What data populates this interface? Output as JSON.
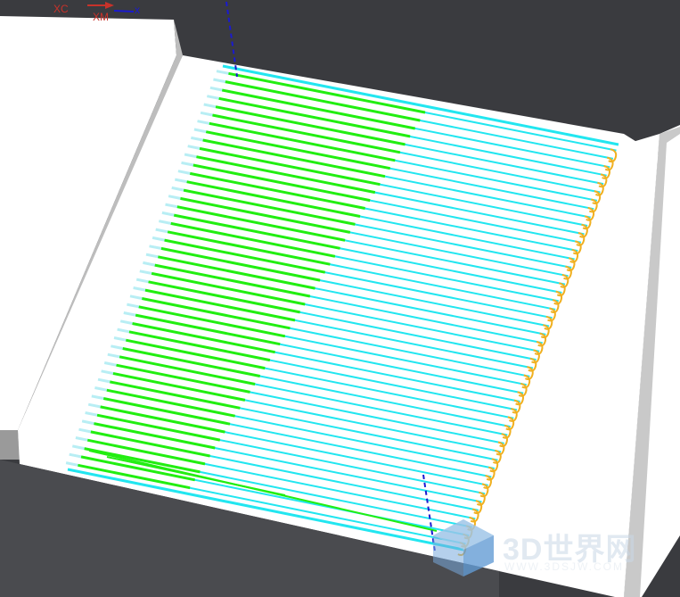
{
  "triad": {
    "xc_label": "XC",
    "xm_label": "XM",
    "x_label": "x",
    "xc_color": "#c8322a",
    "xm_color": "#c8322a",
    "x_color": "#1a1ad0"
  },
  "colors": {
    "background": "#3a3b3f",
    "part_top": "#ffffff",
    "part_wall": "#bdbdbd",
    "part_dark": "#4a4b4f",
    "toolpath_cut": "#22ee11",
    "toolpath_move": "#22e6f0",
    "toolpath_move_light": "#b8eef4",
    "toolpath_arc": "#f0b020",
    "engage_line": "#1a1ad0"
  },
  "toolpath": {
    "pass_count": 48,
    "pattern": "zig parallel"
  },
  "watermark": {
    "logo_text": "3D世界网",
    "url": "WWW.3DSJW.COM"
  }
}
